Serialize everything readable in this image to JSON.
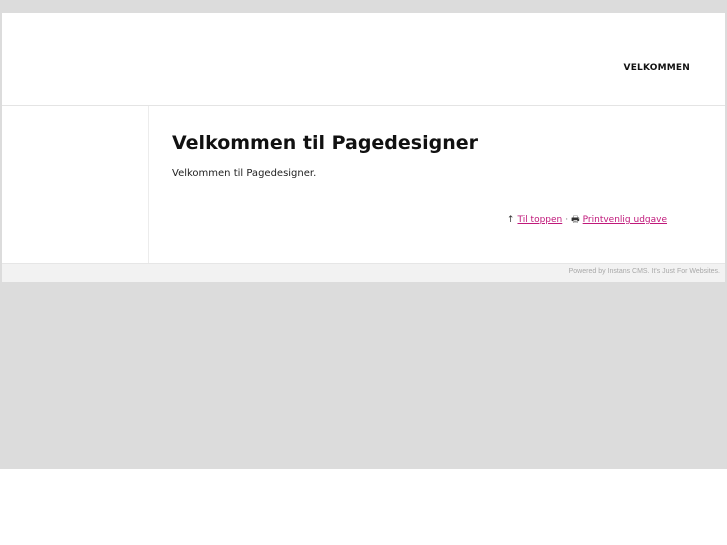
{
  "nav": {
    "items": [
      {
        "label": "VELKOMMEN"
      }
    ]
  },
  "main": {
    "title": "Velkommen til Pagedesigner",
    "body": "Velkommen til Pagedesigner.",
    "tools": {
      "top_icon": "arrow-up-icon",
      "top_glyph": "↑",
      "top_label": "Til toppen",
      "separator": "·",
      "print_icon": "printer-icon",
      "print_glyph": "🖶",
      "print_label": "Printvenlig udgave"
    }
  },
  "footer": {
    "text": "Powered by Instans CMS. It's Just For Websites."
  },
  "colors": {
    "background": "#dcdcdc",
    "link": "#c0187a",
    "text": "#111111"
  }
}
